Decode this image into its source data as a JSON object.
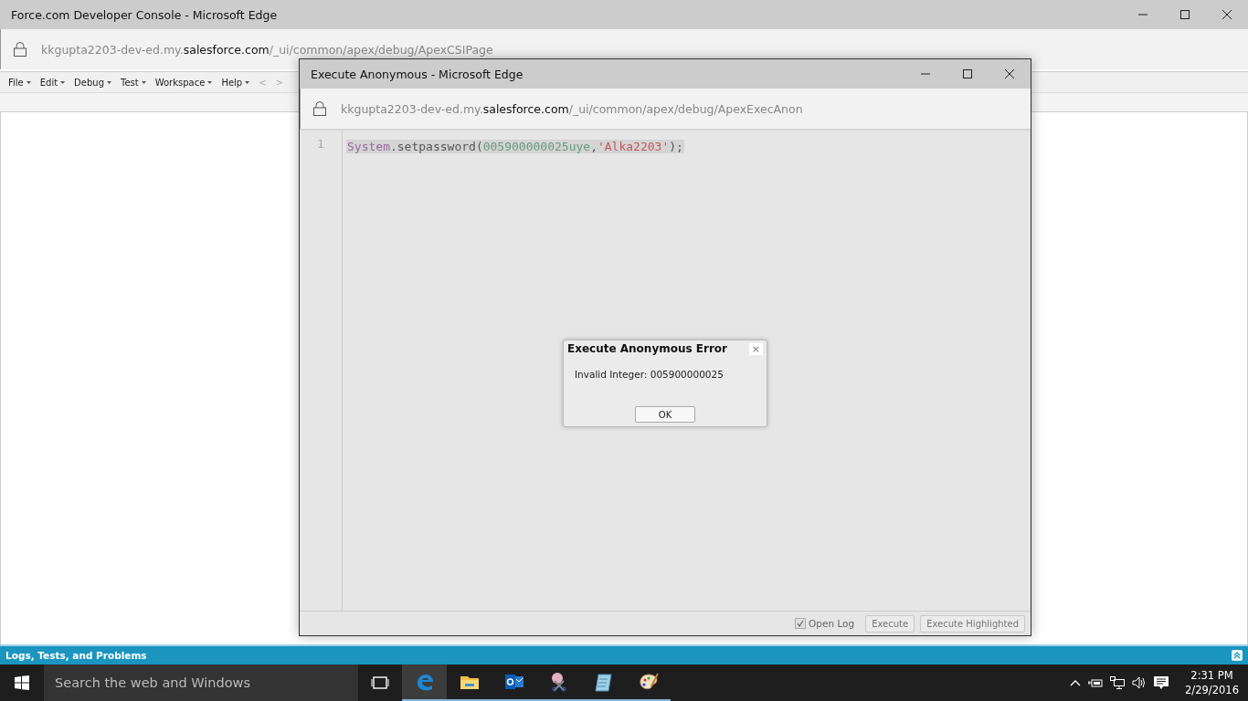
{
  "window": {
    "title": "Force.com Developer Console - Microsoft Edge",
    "address": {
      "host": "kkgupta2203-dev-ed.my.",
      "domain": "salesforce.com",
      "path": "/_ui/common/apex/debug/ApexCSIPage"
    }
  },
  "menu": [
    {
      "label": "File"
    },
    {
      "label": "Edit"
    },
    {
      "label": "Debug"
    },
    {
      "label": "Test"
    },
    {
      "label": "Workspace"
    },
    {
      "label": "Help"
    }
  ],
  "nav": [
    {
      "label": "<"
    },
    {
      "label": ">"
    }
  ],
  "bottom_panel": {
    "title": "Logs, Tests, and Problems"
  },
  "popup": {
    "title": "Execute Anonymous - Microsoft Edge",
    "address": {
      "host": "kkgupta2203-dev-ed.my.",
      "domain": "salesforce.com",
      "path": "/_ui/common/apex/debug/ApexExecAnon"
    },
    "line_number": "1",
    "code": [
      {
        "text": "System",
        "kind": "class"
      },
      {
        "text": ".setpassword(",
        "kind": "plain"
      },
      {
        "text": "005900000025uye",
        "kind": "number"
      },
      {
        "text": ",",
        "kind": "plain"
      },
      {
        "text": "'Alka2203'",
        "kind": "string"
      },
      {
        "text": ");",
        "kind": "plain"
      }
    ],
    "open_log": {
      "label": "Open Log",
      "checked": true
    },
    "buttons": [
      {
        "label": "Execute"
      },
      {
        "label": "Execute Highlighted"
      }
    ]
  },
  "dialog": {
    "title": "Execute Anonymous Error",
    "close": "×",
    "message": "Invalid Integer: 005900000025",
    "button": "OK"
  },
  "taskbar": {
    "search_placeholder": "Search the web and Windows",
    "apps": [
      {
        "kind": "edge",
        "selected": true,
        "running": true
      },
      {
        "kind": "folder",
        "selected": false,
        "running": true
      },
      {
        "kind": "outlook",
        "selected": false,
        "running": true
      },
      {
        "kind": "scissors",
        "selected": false,
        "running": true
      },
      {
        "kind": "notepad",
        "selected": false,
        "running": true
      },
      {
        "kind": "paint",
        "selected": false,
        "running": true
      }
    ],
    "time": "2:31 PM",
    "date": "2/29/2016"
  }
}
